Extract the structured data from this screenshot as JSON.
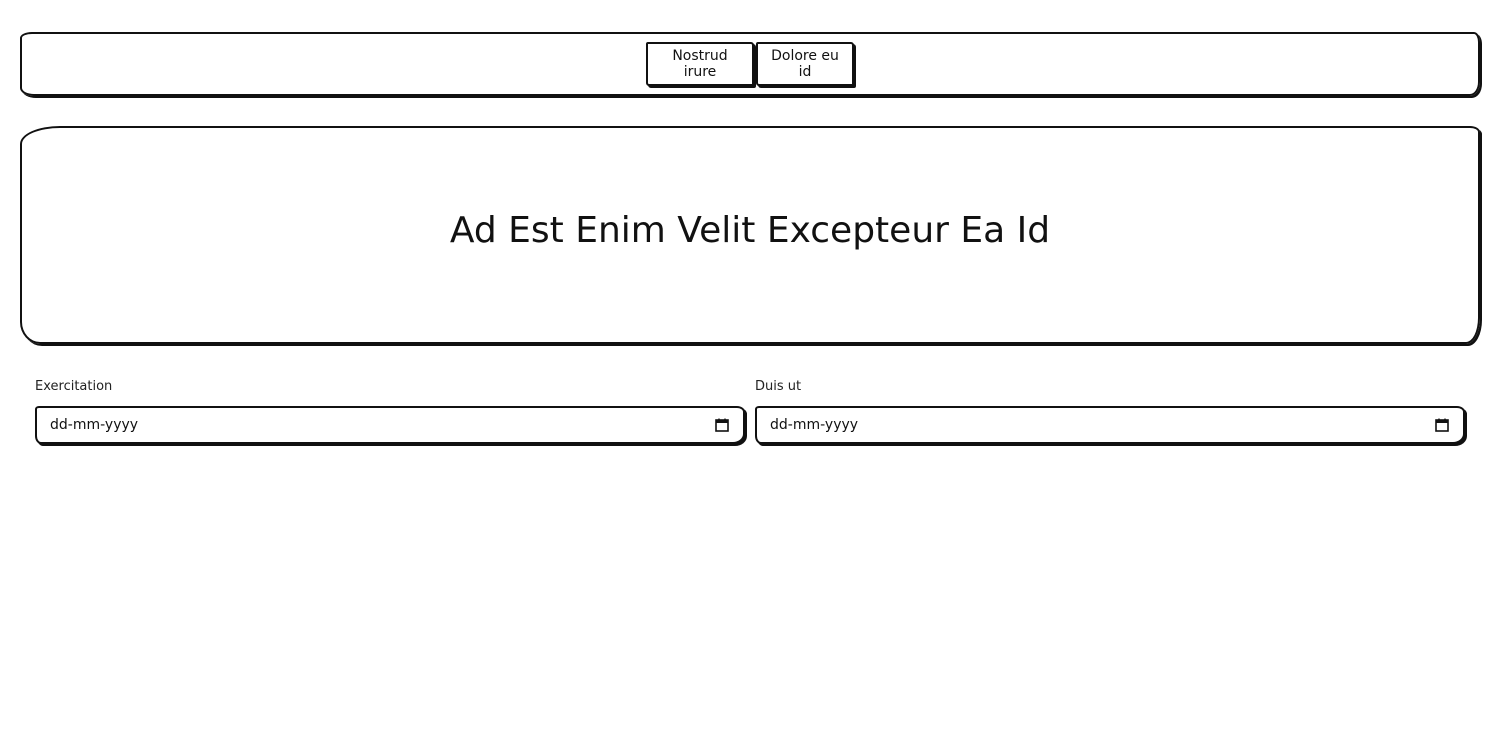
{
  "nav": {
    "buttons": [
      {
        "label": "Nostrud irure"
      },
      {
        "label": "Dolore eu id"
      }
    ]
  },
  "hero": {
    "title": "Ad Est Enim Velit Excepteur Ea Id"
  },
  "form": {
    "fields": [
      {
        "label": "Exercitation",
        "placeholder": "dd-mm-yyyy",
        "icon": "calendar-icon"
      },
      {
        "label": "Duis ut",
        "placeholder": "dd-mm-yyyy",
        "icon": "calendar-icon"
      }
    ]
  }
}
